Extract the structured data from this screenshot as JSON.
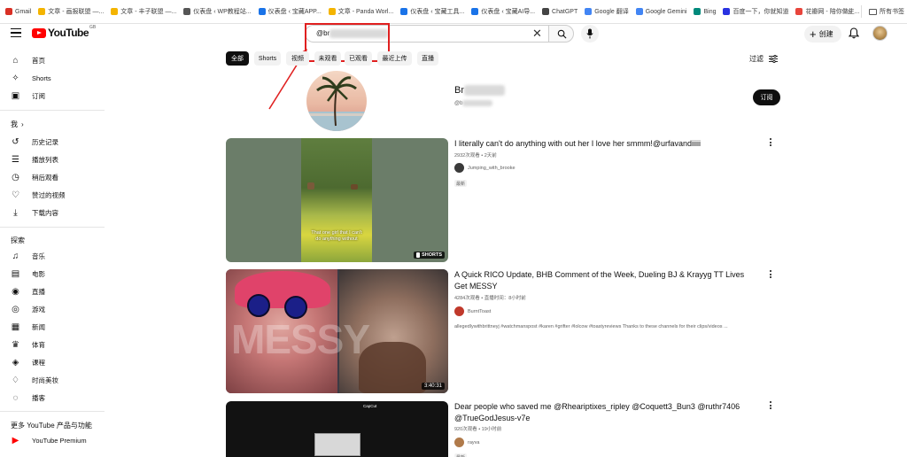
{
  "bookmarks": {
    "items": [
      {
        "label": "Gmail",
        "color": "#d93025"
      },
      {
        "label": "文章 - 画报联盟 —...",
        "color": "#f4b400"
      },
      {
        "label": "文章 - 丰子联盟 —...",
        "color": "#f4b400"
      },
      {
        "label": "仪表盘 ‹ WP教程站...",
        "color": "#555555"
      },
      {
        "label": "仪表盘 ‹ 宝藏APP...",
        "color": "#1a73e8"
      },
      {
        "label": "文章 - Panda Worl...",
        "color": "#f4b400"
      },
      {
        "label": "仪表盘 ‹ 宝藏工具...",
        "color": "#1a73e8"
      },
      {
        "label": "仪表盘 ‹ 宝藏AI导...",
        "color": "#1a73e8"
      },
      {
        "label": "ChatGPT",
        "color": "#444444"
      },
      {
        "label": "Google 翻译",
        "color": "#4285f4"
      },
      {
        "label": "Google Gemini",
        "color": "#4285f4"
      },
      {
        "label": "Bing",
        "color": "#00897b"
      },
      {
        "label": "百度一下，你就知道",
        "color": "#2932e1"
      },
      {
        "label": "花瓣网 - 陪你做生...",
        "color": "#e8453c"
      }
    ],
    "more": "»",
    "folder": "所有书签"
  },
  "header": {
    "logo_text": "YouTube",
    "region": "GB",
    "search_value": "@br",
    "clear_glyph": "✕",
    "create_label": "创建"
  },
  "sidebar": {
    "top": [
      {
        "label": "首页",
        "icon": "home-icon"
      },
      {
        "label": "Shorts",
        "icon": "shorts-icon"
      },
      {
        "label": "订阅",
        "icon": "subscriptions-icon"
      }
    ],
    "you_title": "我",
    "you_chevron": "›",
    "you": [
      {
        "label": "历史记录",
        "icon": "history-icon"
      },
      {
        "label": "播放列表",
        "icon": "playlist-icon"
      },
      {
        "label": "稍后观看",
        "icon": "watch-later-icon"
      },
      {
        "label": "赞过的视频",
        "icon": "like-icon"
      },
      {
        "label": "下载内容",
        "icon": "download-icon"
      }
    ],
    "explore_title": "探索",
    "explore": [
      {
        "label": "音乐",
        "icon": "music-icon"
      },
      {
        "label": "电影",
        "icon": "film-icon"
      },
      {
        "label": "直播",
        "icon": "live-icon"
      },
      {
        "label": "游戏",
        "icon": "gaming-icon"
      },
      {
        "label": "新闻",
        "icon": "news-icon"
      },
      {
        "label": "体育",
        "icon": "sports-icon"
      },
      {
        "label": "课程",
        "icon": "courses-icon"
      },
      {
        "label": "时尚美妆",
        "icon": "fashion-icon"
      },
      {
        "label": "播客",
        "icon": "podcast-icon"
      }
    ],
    "more_title": "更多 YouTube 产品与功能",
    "more": [
      {
        "label": "YouTube Premium",
        "icon": "youtube-premium-icon"
      }
    ]
  },
  "chips": [
    "全部",
    "Shorts",
    "视频",
    "未观看",
    "已观看",
    "最近上传",
    "直播"
  ],
  "filter_label": "过滤",
  "channel": {
    "name": "Br",
    "handle": "@b",
    "subscribe_label": "订阅"
  },
  "videos": [
    {
      "title": "I literally can't do anything with out her I love her smmm!@urfavandiiiii",
      "meta": "2932次观看 • 2天前",
      "channel": "Jumping_with_brooke",
      "badge": "最新",
      "overlay_text": "That one girl that I can't do anything without",
      "shorts_label": "SHORTS",
      "channel_color": "#3a3a3a"
    },
    {
      "title": "A Quick RICO Update, BHB Comment of the Week, Dueling BJ & Krayyg TT Lives Get MESSY",
      "meta": "4284次观看 • 直播时间：8小时前",
      "channel": "BurntToast",
      "desc": "allegedlywithbrittneyj #watchmanspost #karen #grifter #lolcow #toastyreviews Thanks to these channels for their clips/videos ...",
      "duration": "3:40:31",
      "thumb_word": "MESSY",
      "channel_color": "#c0392b"
    },
    {
      "title": "Dear people who saved me @Rheariptixes_ripley @Coquett3_Bun3 @ruthr7406 @TrueGodJesus-v7e",
      "meta": "920次观看 • 19小时前",
      "channel": "rayva",
      "badge": "最新",
      "capcut_label": "CapCut",
      "channel_color": "#b07a4a"
    }
  ],
  "colors": {
    "brand": "#ff0000",
    "annotation": "#e02020"
  }
}
